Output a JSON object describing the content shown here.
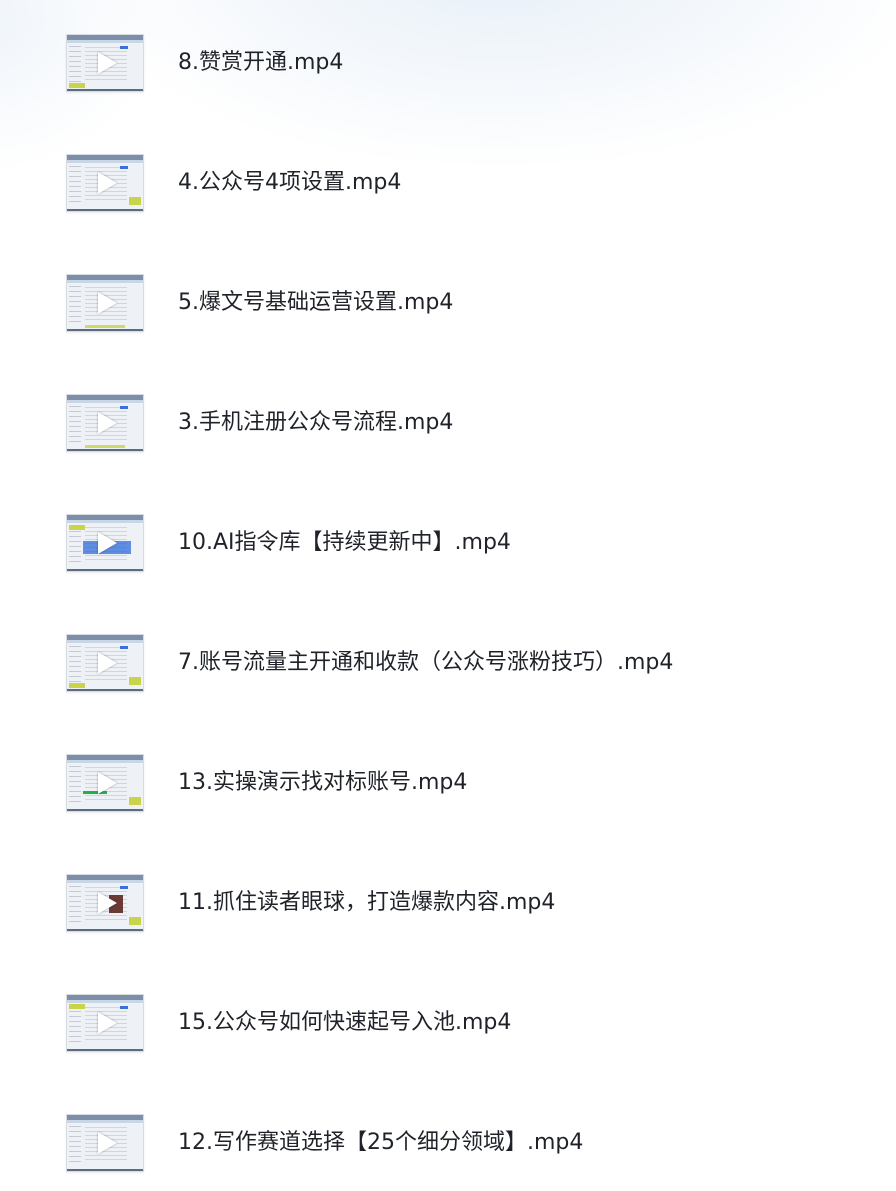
{
  "files": [
    {
      "name": "8.赞赏开通.mp4",
      "thumbnail_icon": "play-icon"
    },
    {
      "name": "4.公众号4项设置.mp4",
      "thumbnail_icon": "play-icon"
    },
    {
      "name": "5.爆文号基础运营设置.mp4",
      "thumbnail_icon": "play-icon"
    },
    {
      "name": "3.手机注册公众号流程.mp4",
      "thumbnail_icon": "play-icon"
    },
    {
      "name": "10.AI指令库【持续更新中】.mp4",
      "thumbnail_icon": "play-icon"
    },
    {
      "name": "7.账号流量主开通和收款（公众号涨粉技巧）.mp4",
      "thumbnail_icon": "play-icon"
    },
    {
      "name": "13.实操演示找对标账号.mp4",
      "thumbnail_icon": "play-icon"
    },
    {
      "name": "11.抓住读者眼球，打造爆款内容.mp4",
      "thumbnail_icon": "play-icon"
    },
    {
      "name": "15.公众号如何快速起号入池.mp4",
      "thumbnail_icon": "play-icon"
    },
    {
      "name": "12.写作赛道选择【25个细分领域】.mp4",
      "thumbnail_icon": "play-icon"
    }
  ],
  "colors": {
    "text": "#1f2329",
    "background": "#ffffff",
    "accent": "#2e6bd9"
  }
}
